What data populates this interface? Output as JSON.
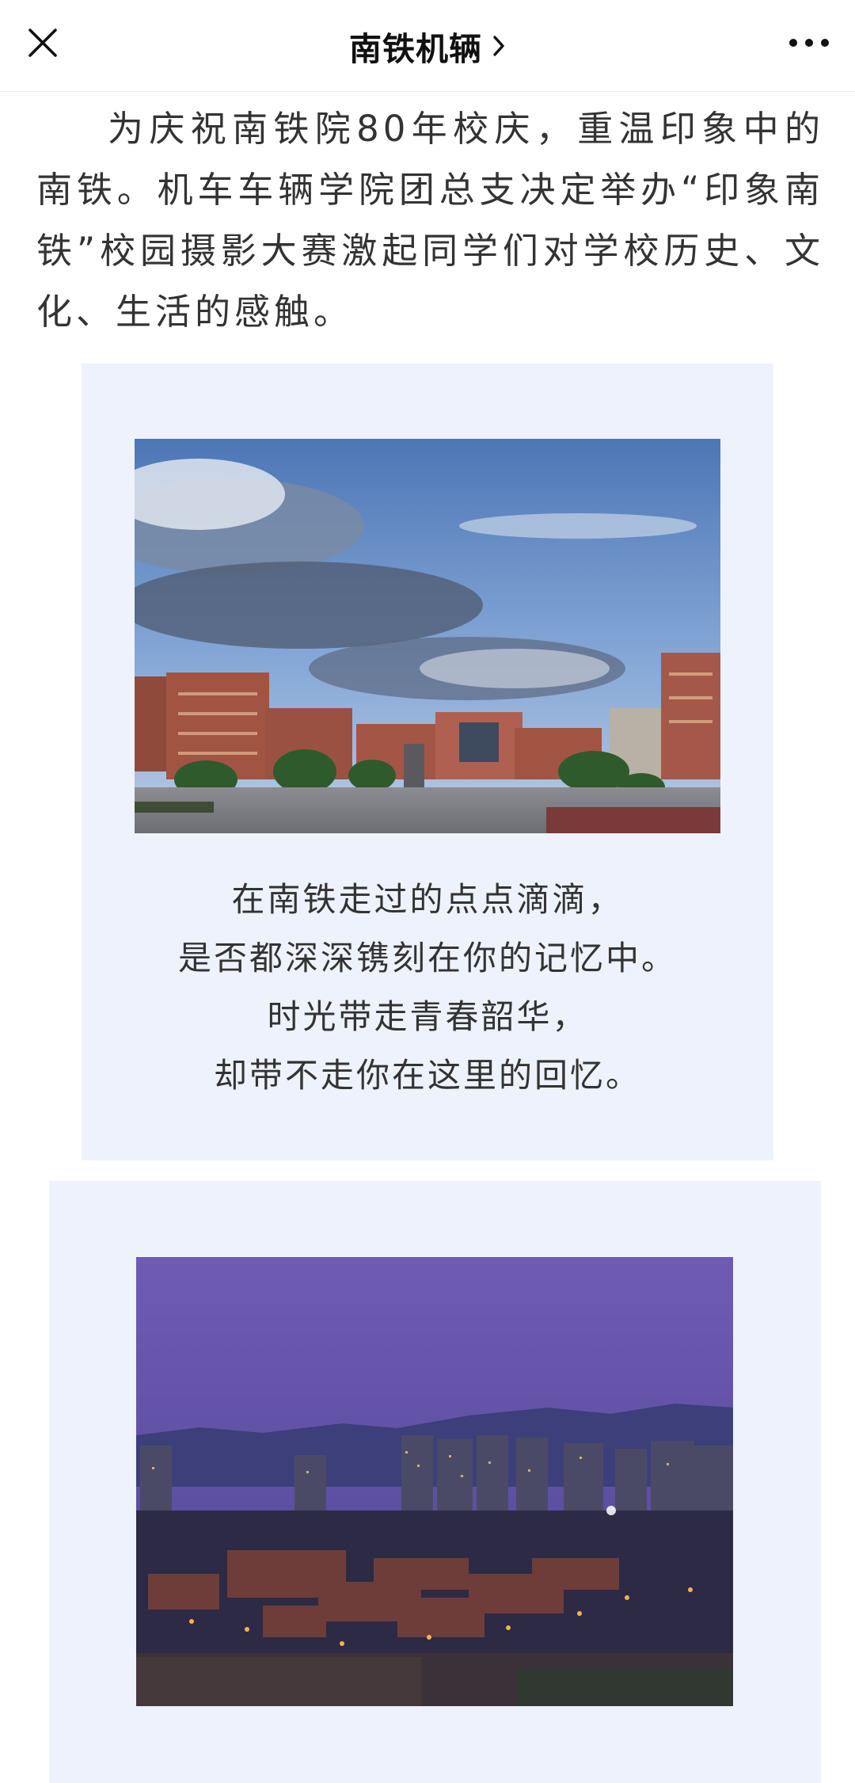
{
  "header": {
    "title": "南铁机辆",
    "close_icon": "close-icon",
    "chevron_icon": "chevron-right-icon",
    "more_icon": "more-dots-icon"
  },
  "article": {
    "intro": "为庆祝南铁院80年校庆，重温印象中的南铁。机车车辆学院团总支决定举办“印象南铁”校园摄影大赛激起同学们对学校历史、文化、生活的感触。",
    "caption_lines": [
      "在南铁走过的点点滴滴，",
      "是否都深深镌刻在你的记忆中。",
      "时光带走青春韶华，",
      "却带不走你在这里的回忆。"
    ]
  },
  "colors": {
    "card_background": "#eef2fc",
    "text": "#333333",
    "title": "#111111"
  }
}
